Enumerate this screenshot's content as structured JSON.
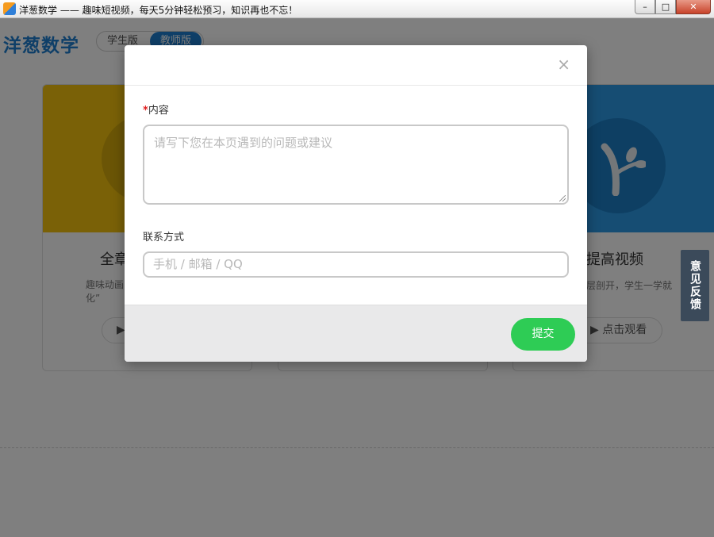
{
  "window": {
    "title": "洋葱数学 —— 趣味短视频，每天5分钟轻松预习，知识再也不忘！",
    "controls": {
      "minimize": "–",
      "maximize": "□",
      "close": "✕"
    }
  },
  "header": {
    "logo": "洋葱数学",
    "versions": [
      "学生版",
      "教师版"
    ],
    "active_version": "教师版"
  },
  "cards": [
    {
      "title": "全章",
      "desc": "趣味动画\n化”",
      "button": "▶"
    },
    {
      "title": "",
      "desc": "",
      "button": ""
    },
    {
      "title": "提高视频",
      "desc": "层剖开，学生一学就",
      "button": "▶ 点击观看"
    }
  ],
  "feedback_tab": "意见反馈",
  "modal": {
    "close": "×",
    "content_required_mark": "*",
    "content_label": "内容",
    "content_placeholder": "请写下您在本页遇到的问题或建议",
    "contact_label": "联系方式",
    "contact_placeholder": "手机 / 邮箱 / QQ",
    "submit": "提交"
  },
  "colors": {
    "brand": "#1f7fd0",
    "submit": "#2ecc55",
    "card1": "#f5c30e",
    "card2": "#ec5b5b",
    "card3": "#2c9be6",
    "required": "#e02020",
    "overlay": "rgba(0,0,0,0.5)"
  }
}
